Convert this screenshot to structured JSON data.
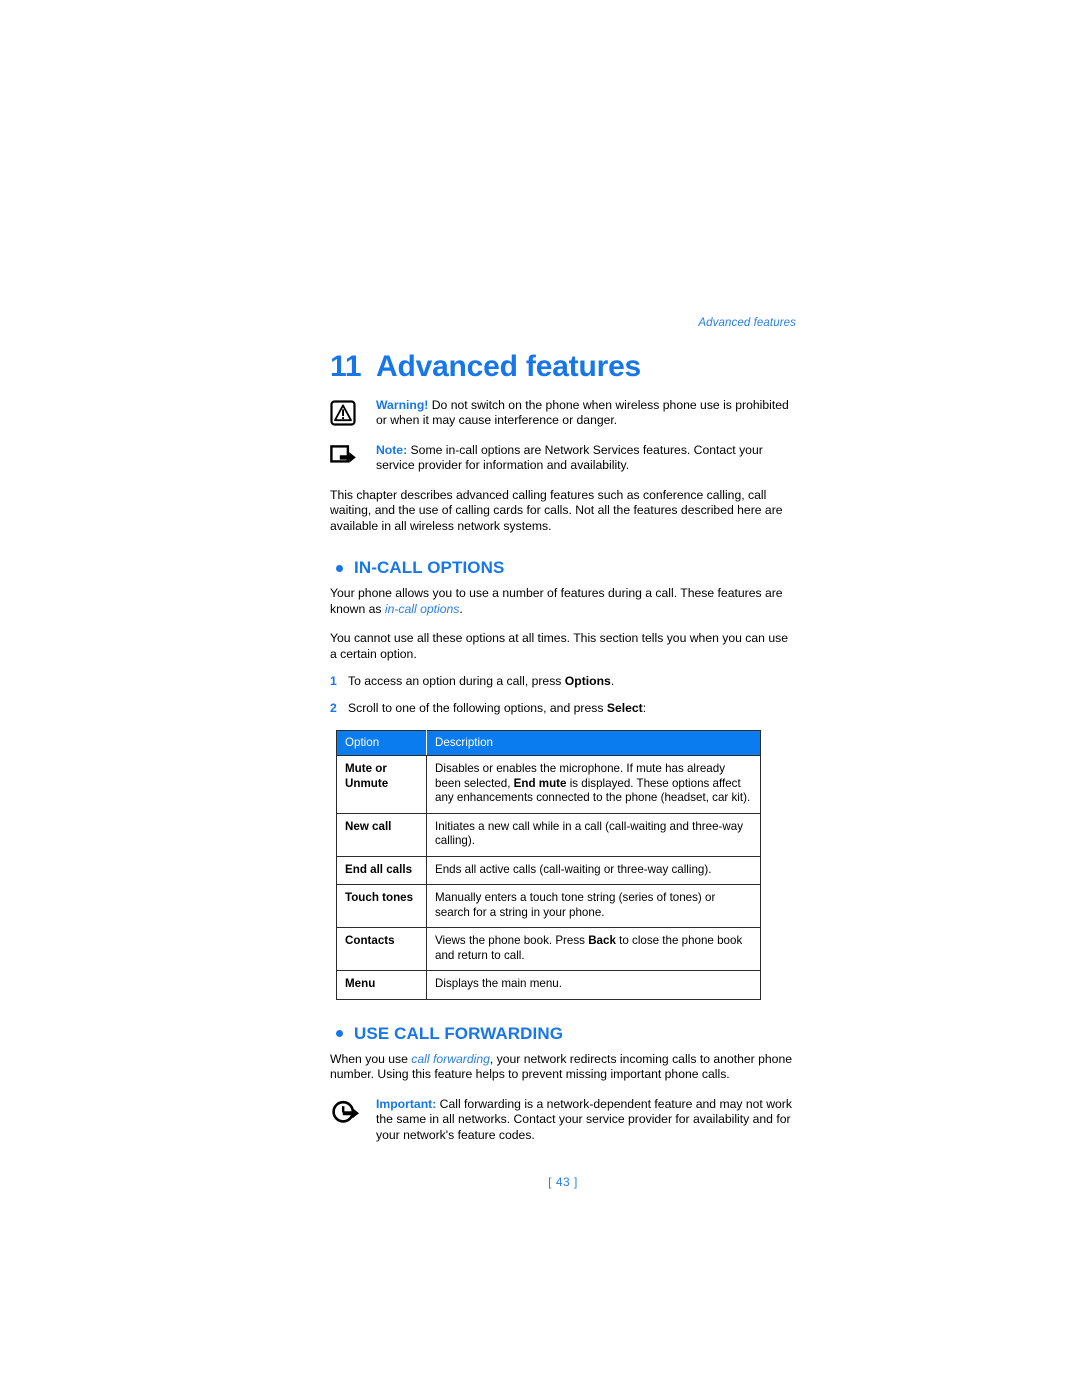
{
  "header": {
    "running_head": "Advanced features"
  },
  "title": {
    "number": "11",
    "name": "Advanced features"
  },
  "notices": [
    {
      "icon": "warning-triangle-icon",
      "lead": "Warning!",
      "text": " Do not switch on the phone when wireless phone use is prohibited or when it may cause interference or danger."
    },
    {
      "icon": "note-arrow-icon",
      "lead": "Note:",
      "text": " Some in-call options are Network Services features. Contact your service provider for information and availability."
    }
  ],
  "intro_paragraph": "This chapter describes advanced calling features such as conference calling, call waiting, and the use of calling cards for calls. Not all the features described here are available in all wireless network systems.",
  "sections": [
    {
      "heading": "IN-CALL OPTIONS",
      "paragraph_1_a": "Your phone allows you to use a number of features during a call. These features are known as ",
      "paragraph_1_italic": "in-call options",
      "paragraph_1_b": ".",
      "paragraph_2": "You cannot use all these options at all times. This section tells you when you can use a certain option.",
      "steps": [
        {
          "num": "1",
          "text_a": "To access an option during a call, press ",
          "bold": "Options",
          "text_b": "."
        },
        {
          "num": "2",
          "text_a": "Scroll to one of the following options, and press ",
          "bold": "Select",
          "text_b": ":"
        }
      ]
    },
    {
      "heading": "USE CALL FORWARDING",
      "paragraph_a": "When you use ",
      "paragraph_italic": "call forwarding",
      "paragraph_b": ", your network redirects incoming calls to another phone number. Using this feature helps to prevent missing important phone calls."
    }
  ],
  "table": {
    "columns": [
      "Option",
      "Description"
    ],
    "rows": [
      {
        "option": "Mute or Unmute",
        "desc_a": "Disables or enables the microphone. If mute has already been selected, ",
        "desc_bold": "End mute",
        "desc_b": " is displayed. These options affect any enhancements connected to the phone (headset, car kit)."
      },
      {
        "option": "New call",
        "desc_a": "Initiates a new call while in a call (call-waiting and three-way calling).",
        "desc_bold": "",
        "desc_b": ""
      },
      {
        "option": "End all calls",
        "desc_a": "Ends all active calls (call-waiting or three-way calling).",
        "desc_bold": "",
        "desc_b": ""
      },
      {
        "option": "Touch tones",
        "desc_a": "Manually enters a touch tone string (series of tones) or search for a string in your phone.",
        "desc_bold": "",
        "desc_b": ""
      },
      {
        "option": "Contacts",
        "desc_a": "Views the phone book. Press ",
        "desc_bold": "Back",
        "desc_b": " to close the phone book and return to call."
      },
      {
        "option": "Menu",
        "desc_a": "Displays the main menu.",
        "desc_bold": "",
        "desc_b": ""
      }
    ]
  },
  "important_notice": {
    "icon": "important-circle-arrow-icon",
    "lead": "Important:",
    "text": " Call forwarding is a network-dependent feature and may not work the same in all networks. Contact your service provider for availability and for your network's feature codes."
  },
  "page_number": "[ 43 ]",
  "colors": {
    "accent_blue": "#1877e8",
    "table_header_blue": "#0b7cf0",
    "italic_blue": "#2a7fe8",
    "rule_black": "#2b2b2b"
  }
}
